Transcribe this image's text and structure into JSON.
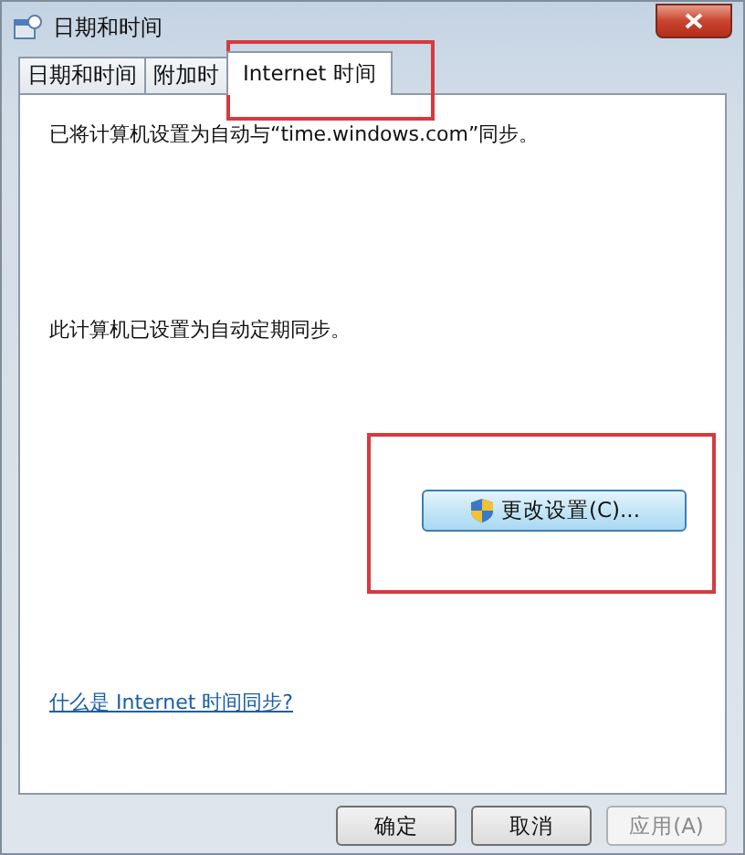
{
  "window": {
    "title": "日期和时间"
  },
  "tabs": [
    {
      "label": "日期和时间",
      "selected": false
    },
    {
      "label": "附加时",
      "selected": false
    },
    {
      "label": "Internet 时间",
      "selected": true
    }
  ],
  "status_text": "已将计算机设置为自动与“time.windows.com”同步。",
  "schedule_text": "此计算机已设置为自动定期同步。",
  "change_button": {
    "label": "更改设置(C)..."
  },
  "help_link": "什么是 Internet 时间同步?",
  "buttons": [
    {
      "label": "确定",
      "disabled": false
    },
    {
      "label": "取消",
      "disabled": false
    },
    {
      "label": "应用(A)",
      "disabled": true
    }
  ]
}
